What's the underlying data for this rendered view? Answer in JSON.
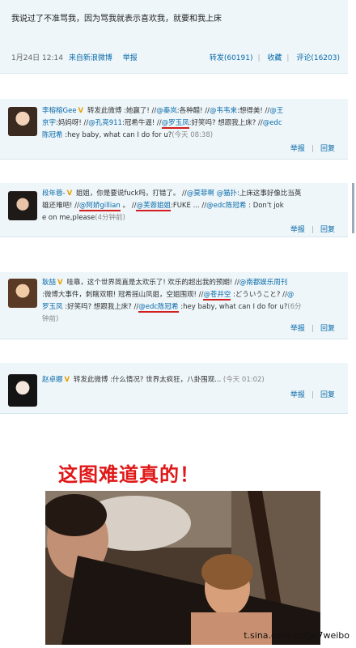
{
  "top_post": {
    "text": "我说过了不准骂我，因为骂我就表示喜欢我，就要和我上床",
    "date": "1月24日 12:14",
    "source": "来自新浪微博",
    "report": "举报",
    "repost": "转发(60191)",
    "favorite": "收藏",
    "comment": "评论(16203)"
  },
  "reposts": [
    {
      "name": "李榕榕Gee",
      "lines": [
        [
          {
            "t": "转发此微博 :她赢了!  //"
          },
          {
            "t": "@秦岚",
            "link": true
          },
          {
            "t": ":各种醋!  //"
          },
          {
            "t": "@韦韦来",
            "link": true
          },
          {
            "t": ":想得美!  //"
          },
          {
            "t": "@王",
            "link": true
          }
        ],
        [
          {
            "t": "京宇",
            "link": true
          },
          {
            "t": ":妈妈呀!  //"
          },
          {
            "t": "@孔亮911",
            "link": true
          },
          {
            "t": ":冠希牛逼!  //"
          },
          {
            "t": "@罗玉凤",
            "link": true,
            "ul": true
          },
          {
            "t": ":好笑吗? 想跟我上床?  //"
          },
          {
            "t": "@edc",
            "link": true
          }
        ],
        [
          {
            "t": "陈冠希",
            "link": true
          },
          {
            "t": " :hey baby, what can I do for u?"
          },
          {
            "t": "(今天 08:38)",
            "time": true
          }
        ]
      ],
      "report": "举报",
      "reply": "回复"
    },
    {
      "name": "段年蓉-",
      "lines": [
        [
          {
            "t": "姐姐，你是要说fuck吗，打错了。 //"
          },
          {
            "t": "@莫菲啊",
            "link": true
          },
          {
            "t": " "
          },
          {
            "t": "@猫扑",
            "link": true
          },
          {
            "t": ":上床这事好像比当英"
          }
        ],
        [
          {
            "t": "雄还难吧!  //"
          },
          {
            "t": "@阿娇gillian",
            "link": true,
            "ul": true
          },
          {
            "t": " 。  //"
          },
          {
            "t": "@芙蓉姐姐",
            "link": true,
            "ul": true
          },
          {
            "t": ":FUKE ...  //"
          },
          {
            "t": "@edc陈冠希",
            "link": true
          },
          {
            "t": " : Don't jok"
          }
        ],
        [
          {
            "t": "e on me,please"
          },
          {
            "t": "(4分钟前)",
            "time": true
          }
        ]
      ],
      "report": "举报",
      "reply": "回复"
    },
    {
      "name": "耿喆",
      "lines": [
        [
          {
            "t": "哇靠，这个世界简直是太欢乐了! 欢乐的超出我的预期!  //"
          },
          {
            "t": "@南都娱乐周刊",
            "link": true
          }
        ],
        [
          {
            "t": ":微博大事件，刺瞎双眼! 冠希摇山凤姐，空姐围观!  //"
          },
          {
            "t": "@苍井空",
            "link": true,
            "ul": true
          },
          {
            "t": " :どういうこと? //"
          },
          {
            "t": "@",
            "link": true
          }
        ],
        [
          {
            "t": "罗玉凤",
            "link": true
          },
          {
            "t": " :好笑吗? 想跟我上床? //"
          },
          {
            "t": "@edc陈冠希",
            "link": true,
            "ul": true
          },
          {
            "t": " :hey baby, what can I do for u?"
          },
          {
            "t": "(6分",
            "time": true
          }
        ],
        [
          {
            "t": "钟前)",
            "time": true
          }
        ]
      ],
      "report": "举报",
      "reply": "回复"
    },
    {
      "name": "赵卓娜",
      "lines": [
        [
          {
            "t": "转发此微博 :什么情况? 世界太疯狂，八卦围观...  "
          },
          {
            "t": "(今天 01:02)",
            "time": true
          }
        ]
      ],
      "report": "举报",
      "reply": "回复"
    }
  ],
  "headline": "这图难道真的！",
  "watermark": "t.sina.com.cn/go7weibo"
}
